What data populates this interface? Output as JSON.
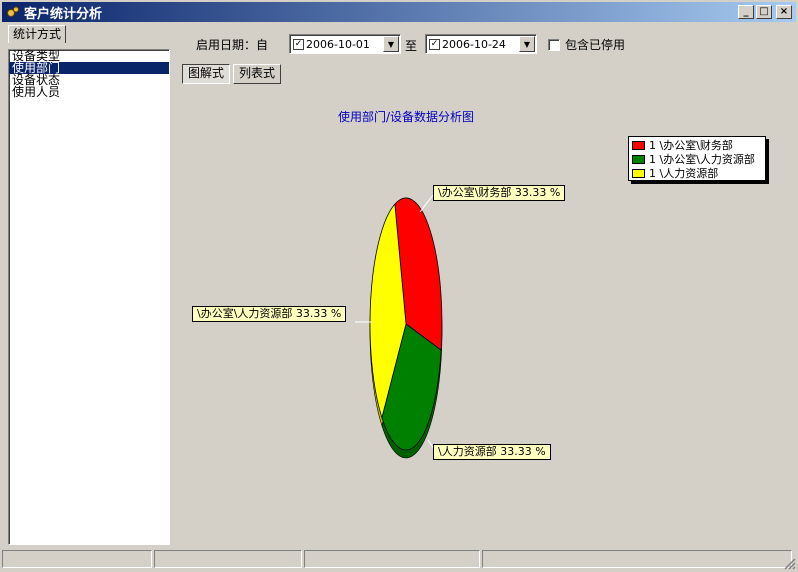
{
  "window": {
    "title": "客户统计分析",
    "buttons": {
      "minimize": "_",
      "maximize": "□",
      "close": "×"
    }
  },
  "left_panel": {
    "tab_label": "统计方式",
    "items": [
      {
        "label": "设备类型",
        "selected": false
      },
      {
        "label": "使用部门",
        "selected": true
      },
      {
        "label": "设备状态",
        "selected": false
      },
      {
        "label": "使用人员",
        "selected": false
      }
    ]
  },
  "filters": {
    "date_label": "启用日期：自",
    "from_date": "2006-10-01",
    "to_label": "至",
    "to_date": "2006-10-24",
    "include_disabled_label": "包含已停用",
    "include_disabled_checked": false
  },
  "view_modes": {
    "chart_label": "图解式",
    "list_label": "列表式",
    "active": "chart"
  },
  "chart_data": {
    "type": "pie",
    "title": "使用部门/设备数据分析图",
    "slices": [
      {
        "name": "\\办公室\\财务部",
        "value": 1,
        "percent_label": "\\办公室\\财务部 33.33 %",
        "legend": "1 \\办公室\\财务部",
        "color": "#ff0000"
      },
      {
        "name": "\\办公室\\人力资源部",
        "value": 1,
        "percent_label": "\\办公室\\人力资源部 33.33 %",
        "legend": "1 \\办公室\\人力资源部",
        "color": "#008000"
      },
      {
        "name": "\\人力资源部",
        "value": 1,
        "percent_label": "\\人力资源部 33.33 %",
        "legend": "1 \\人力资源部",
        "color": "#ffff00"
      }
    ],
    "legend_position": "top-right"
  }
}
